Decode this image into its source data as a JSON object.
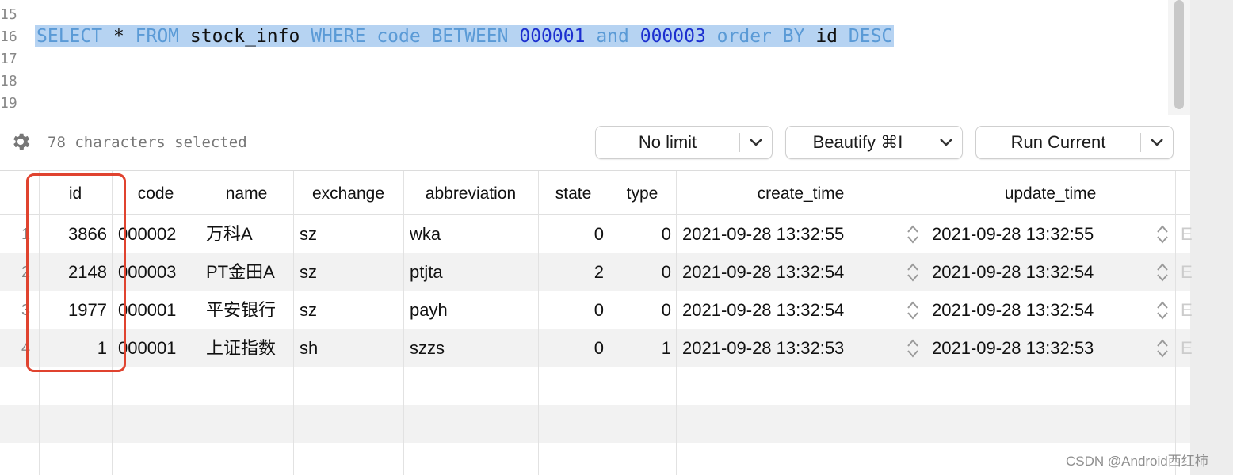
{
  "editor": {
    "line_numbers": [
      "15",
      "16",
      "17",
      "18",
      "19"
    ],
    "query_tokens": [
      {
        "text": "SELECT",
        "kind": "kw"
      },
      {
        "text": " * ",
        "kind": "plain"
      },
      {
        "text": "FROM",
        "kind": "kw"
      },
      {
        "text": " stock_info ",
        "kind": "plain"
      },
      {
        "text": "WHERE",
        "kind": "kw"
      },
      {
        "text": " ",
        "kind": "plain"
      },
      {
        "text": "code",
        "kind": "kw"
      },
      {
        "text": " ",
        "kind": "plain"
      },
      {
        "text": "BETWEEN",
        "kind": "kw"
      },
      {
        "text": " ",
        "kind": "plain"
      },
      {
        "text": "000001",
        "kind": "num"
      },
      {
        "text": " ",
        "kind": "plain"
      },
      {
        "text": "and",
        "kind": "kw"
      },
      {
        "text": " ",
        "kind": "plain"
      },
      {
        "text": "000003",
        "kind": "num"
      },
      {
        "text": " ",
        "kind": "plain"
      },
      {
        "text": "order",
        "kind": "kw"
      },
      {
        "text": " ",
        "kind": "plain"
      },
      {
        "text": "BY",
        "kind": "kw"
      },
      {
        "text": " id ",
        "kind": "plain"
      },
      {
        "text": "DESC",
        "kind": "kw"
      }
    ]
  },
  "toolbar": {
    "status": "78 characters selected",
    "limit_label": "No limit",
    "beautify_label": "Beautify ⌘I",
    "run_label": "Run Current"
  },
  "grid": {
    "columns": [
      "id",
      "code",
      "name",
      "exchange",
      "abbreviation",
      "state",
      "type",
      "create_time",
      "update_time"
    ],
    "rows": [
      {
        "num": "1",
        "id": "3866",
        "code": "000002",
        "name": "万科A",
        "exchange": "sz",
        "abbreviation": "wka",
        "state": "0",
        "type": "0",
        "create_time": "2021-09-28 13:32:55",
        "update_time": "2021-09-28 13:32:55"
      },
      {
        "num": "2",
        "id": "2148",
        "code": "000003",
        "name": "PT金田A",
        "exchange": "sz",
        "abbreviation": "ptjta",
        "state": "2",
        "type": "0",
        "create_time": "2021-09-28 13:32:54",
        "update_time": "2021-09-28 13:32:54"
      },
      {
        "num": "3",
        "id": "1977",
        "code": "000001",
        "name": "平安银行",
        "exchange": "sz",
        "abbreviation": "payh",
        "state": "0",
        "type": "0",
        "create_time": "2021-09-28 13:32:54",
        "update_time": "2021-09-28 13:32:54"
      },
      {
        "num": "4",
        "id": "1",
        "code": "000001",
        "name": "上证指数",
        "exchange": "sh",
        "abbreviation": "szzs",
        "state": "0",
        "type": "1",
        "create_time": "2021-09-28 13:32:53",
        "update_time": "2021-09-28 13:32:53"
      }
    ],
    "overflow_glyph": "E"
  },
  "watermark": "CSDN @Android西红柿",
  "colors": {
    "selection": "#b6d3f2",
    "keyword": "#5a9ad6",
    "number": "#1c2fcf",
    "highlight_box": "#e0432f"
  }
}
